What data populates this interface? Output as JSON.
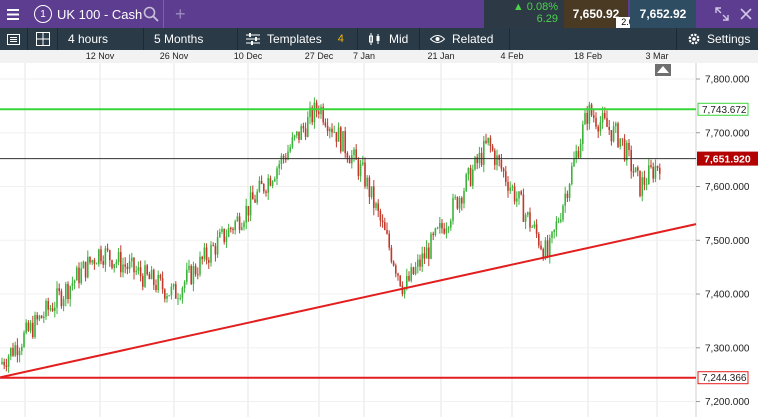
{
  "header": {
    "menu_icon": "hamburger-menu-icon",
    "window_number": "1",
    "instrument": "UK 100 - Cash",
    "change_percent": "0.08%",
    "change_points": "6.29",
    "sell_price": "7,650.92",
    "spread": "2.00",
    "buy_price": "7,652.92"
  },
  "toolbar": {
    "interval": "4 hours",
    "period": "5 Months",
    "templates_label": "Templates",
    "templates_count": "4",
    "price_type": "Mid",
    "related_label": "Related",
    "settings_label": "Settings"
  },
  "chart_data": {
    "type": "candlestick",
    "x_labels": [
      "12 Nov",
      "26 Nov",
      "10 Dec",
      "27 Dec",
      "7 Jan",
      "21 Jan",
      "4 Feb",
      "18 Feb",
      "3 Mar"
    ],
    "y_ticks": [
      "7,800.000",
      "7,700.000",
      "7,600.000",
      "7,500.000",
      "7,400.000",
      "7,300.000",
      "7,200.000"
    ],
    "y_range": [
      7190,
      7820
    ],
    "current_price": "7,651.920",
    "horizontal_lines": [
      {
        "label": "7,743.672",
        "color": "#39d639"
      },
      {
        "label": "7,244.366",
        "color": "#e31e1e"
      }
    ],
    "trend_lines": [
      {
        "color": "#e31e1e",
        "from_price": 7245,
        "to_price": 7530
      }
    ],
    "key_points": [
      {
        "date": "start",
        "price": 7270
      },
      {
        "date": "12 Nov",
        "price": 7480
      },
      {
        "date": "26 Nov",
        "price": 7400
      },
      {
        "date": "10 Dec",
        "price": 7560
      },
      {
        "date": "27 Dec",
        "price": 7750
      },
      {
        "date": "7 Jan",
        "price": 7620
      },
      {
        "date": "15 Jan",
        "price": 7410
      },
      {
        "date": "21 Jan",
        "price": 7520
      },
      {
        "date": "28 Jan",
        "price": 7680
      },
      {
        "date": "10 Feb",
        "price": 7470
      },
      {
        "date": "18 Feb",
        "price": 7740
      },
      {
        "date": "25 Feb",
        "price": 7690
      },
      {
        "date": "1 Mar",
        "price": 7600
      },
      {
        "date": "3 Mar",
        "price": 7651
      }
    ]
  }
}
